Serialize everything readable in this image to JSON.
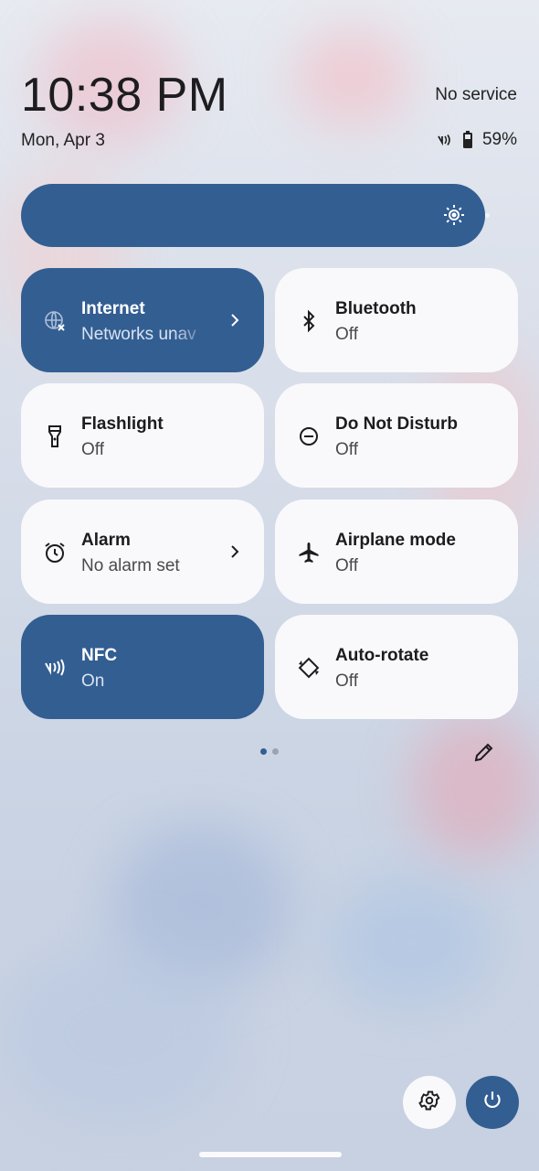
{
  "status": {
    "time": "10:38 PM",
    "date": "Mon, Apr 3",
    "carrier": "No service",
    "battery": "59%"
  },
  "brightness": {
    "level": 0.93,
    "icon": "brightness-icon"
  },
  "tiles": [
    {
      "title": "Internet",
      "subtitle": "Networks unav",
      "state": "on",
      "icon": "internet-off-icon",
      "has_chevron": true
    },
    {
      "title": "Bluetooth",
      "subtitle": "Off",
      "state": "off",
      "icon": "bluetooth-icon",
      "has_chevron": false
    },
    {
      "title": "Flashlight",
      "subtitle": "Off",
      "state": "off",
      "icon": "flashlight-icon",
      "has_chevron": false
    },
    {
      "title": "Do Not Disturb",
      "subtitle": "Off",
      "state": "off",
      "icon": "do-not-disturb-icon",
      "has_chevron": false
    },
    {
      "title": "Alarm",
      "subtitle": "No alarm set",
      "state": "off",
      "icon": "alarm-icon",
      "has_chevron": true
    },
    {
      "title": "Airplane mode",
      "subtitle": "Off",
      "state": "off",
      "icon": "airplane-icon",
      "has_chevron": false
    },
    {
      "title": "NFC",
      "subtitle": "On",
      "state": "on",
      "icon": "nfc-icon",
      "has_chevron": false
    },
    {
      "title": "Auto-rotate",
      "subtitle": "Off",
      "state": "off",
      "icon": "auto-rotate-icon",
      "has_chevron": false
    }
  ],
  "pager": {
    "pages": 2,
    "current": 1
  },
  "colors": {
    "accent": "#335e92",
    "tile_off": "#f9f9fb"
  }
}
